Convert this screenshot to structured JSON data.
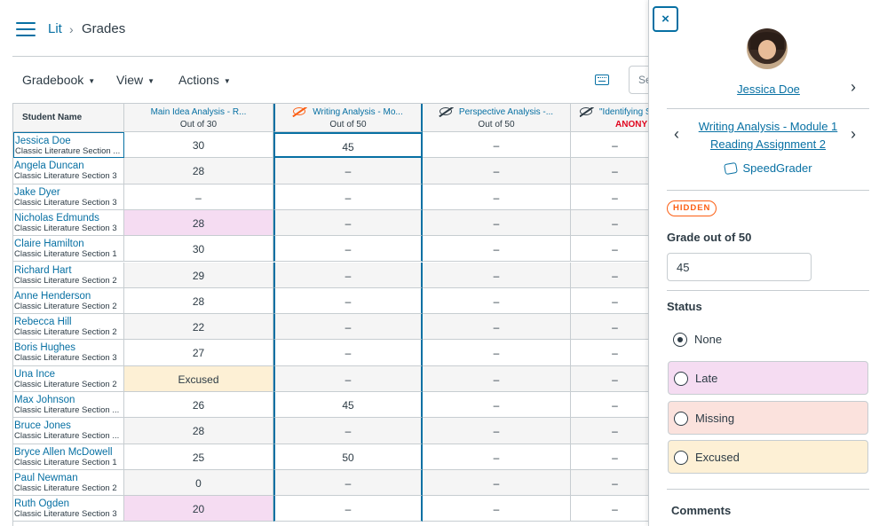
{
  "breadcrumb": {
    "course": "Lit",
    "separator": "›",
    "page": "Grades"
  },
  "toolbar": {
    "gradebook": "Gradebook",
    "view": "View",
    "actions": "Actions",
    "search_placeholder": "Se"
  },
  "columns": [
    {
      "title": "Student Name",
      "subtitle": ""
    },
    {
      "title": "Main Idea Analysis - R...",
      "subtitle": "Out of 30"
    },
    {
      "title": "Writing Analysis - Mo...",
      "subtitle": "Out of 50",
      "hidden": true
    },
    {
      "title": "Perspective Analysis -...",
      "subtitle": "Out of 50",
      "hidden": true
    },
    {
      "title": "\"Identifying S",
      "subtitle": "ANONY",
      "hidden": true
    }
  ],
  "rows": [
    {
      "name": "Jessica Doe",
      "section": "Classic Literature Section ...",
      "c1": "30",
      "c2": "45",
      "c3": "–",
      "c4": "–"
    },
    {
      "name": "Angela Duncan",
      "section": "Classic Literature Section 3",
      "c1": "28",
      "c2": "–",
      "c3": "–",
      "c4": "–"
    },
    {
      "name": "Jake Dyer",
      "section": "Classic Literature Section 3",
      "c1": "–",
      "c2": "–",
      "c3": "–",
      "c4": "–"
    },
    {
      "name": "Nicholas Edmunds",
      "section": "Classic Literature Section 3",
      "c1": "28",
      "c2": "–",
      "c3": "–",
      "c4": "–"
    },
    {
      "name": "Claire Hamilton",
      "section": "Classic Literature Section 1",
      "c1": "30",
      "c2": "–",
      "c3": "–",
      "c4": "–"
    },
    {
      "name": "Richard Hart",
      "section": "Classic Literature Section 2",
      "c1": "29",
      "c2": "–",
      "c3": "–",
      "c4": "–"
    },
    {
      "name": "Anne Henderson",
      "section": "Classic Literature Section 2",
      "c1": "28",
      "c2": "–",
      "c3": "–",
      "c4": "–"
    },
    {
      "name": "Rebecca Hill",
      "section": "Classic Literature Section 2",
      "c1": "22",
      "c2": "–",
      "c3": "–",
      "c4": "–"
    },
    {
      "name": "Boris Hughes",
      "section": "Classic Literature Section 3",
      "c1": "27",
      "c2": "–",
      "c3": "–",
      "c4": "–"
    },
    {
      "name": "Una Ince",
      "section": "Classic Literature Section 2",
      "c1": "Excused",
      "c2": "–",
      "c3": "–",
      "c4": "–"
    },
    {
      "name": "Max Johnson",
      "section": "Classic Literature Section ...",
      "c1": "26",
      "c2": "45",
      "c3": "–",
      "c4": "–"
    },
    {
      "name": "Bruce Jones",
      "section": "Classic Literature Section ...",
      "c1": "28",
      "c2": "–",
      "c3": "–",
      "c4": "–"
    },
    {
      "name": "Bryce Allen McDowell",
      "section": "Classic Literature Section 1",
      "c1": "25",
      "c2": "50",
      "c3": "–",
      "c4": "–"
    },
    {
      "name": "Paul Newman",
      "section": "Classic Literature Section 2",
      "c1": "0",
      "c2": "–",
      "c3": "–",
      "c4": "–"
    },
    {
      "name": "Ruth Ogden",
      "section": "Classic Literature Section 3",
      "c1": "20",
      "c2": "–",
      "c3": "–",
      "c4": "–"
    }
  ],
  "tray": {
    "close": "×",
    "student": "Jessica Doe",
    "assignment_line1": "Writing Analysis - Module 1",
    "assignment_line2": "Reading Assignment 2",
    "speedgrader": "SpeedGrader",
    "hidden_badge": "HIDDEN",
    "grade_label": "Grade out of 50",
    "grade_value": "45",
    "status_label": "Status",
    "status_options": [
      "None",
      "Late",
      "Missing",
      "Excused"
    ],
    "comments_label": "Comments"
  },
  "colors": {
    "link": "#0770a3",
    "late": "#f5dcf2",
    "missing": "#fbe2dd",
    "excused": "#fdf0d5",
    "hidden": "#fc5e13",
    "anonymous": "#e0061f"
  }
}
